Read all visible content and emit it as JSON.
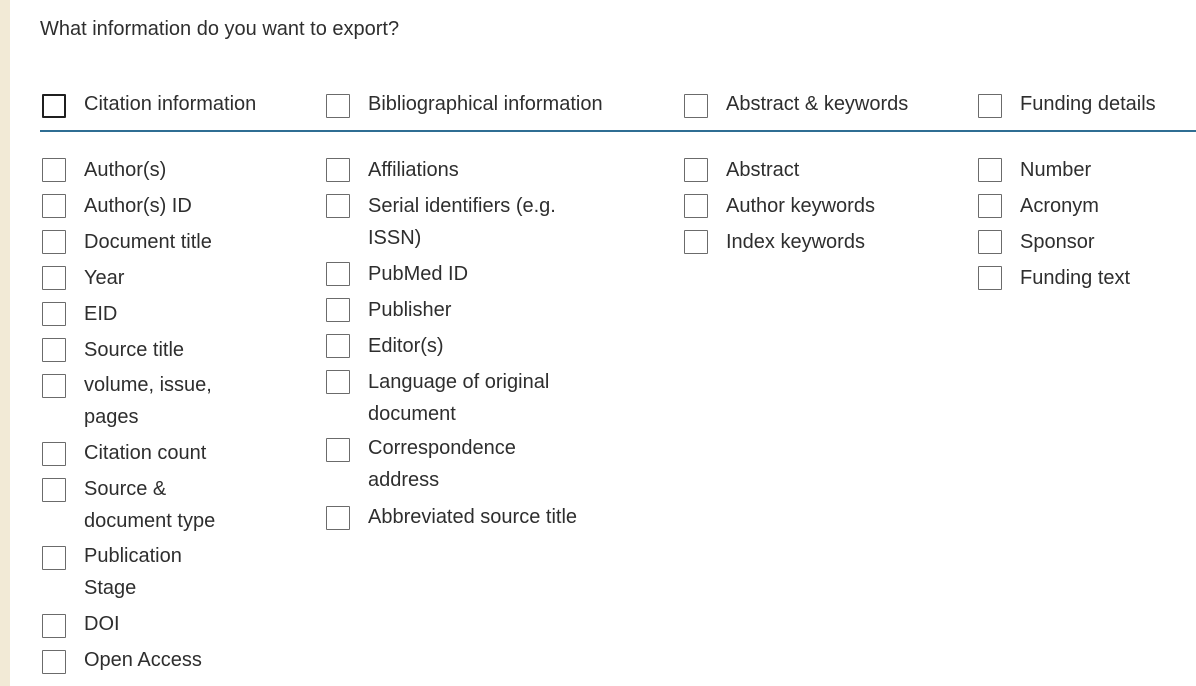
{
  "question": "What information do you want to export?",
  "groups": {
    "citation": {
      "label": "Citation information",
      "items": [
        "Author(s)",
        "Author(s) ID",
        "Document title",
        "Year",
        "EID",
        "Source title",
        "volume, issue,",
        "pages",
        "Citation count",
        "Source &",
        "document type",
        "Publication",
        "Stage",
        "DOI",
        "Open Access"
      ]
    },
    "bibliographical": {
      "label": "Bibliographical information",
      "items": [
        "Affiliations",
        "Serial identifiers (e.g.",
        "ISSN)",
        "PubMed ID",
        "Publisher",
        "Editor(s)",
        "Language of original",
        "document",
        "Correspondence",
        "address",
        "Abbreviated source title"
      ]
    },
    "abstract": {
      "label": "Abstract & keywords",
      "items": [
        "Abstract",
        "Author keywords",
        "Index keywords"
      ]
    },
    "funding": {
      "label": "Funding details",
      "items": [
        "Number",
        "Acronym",
        "Sponsor",
        "Funding text"
      ]
    }
  }
}
